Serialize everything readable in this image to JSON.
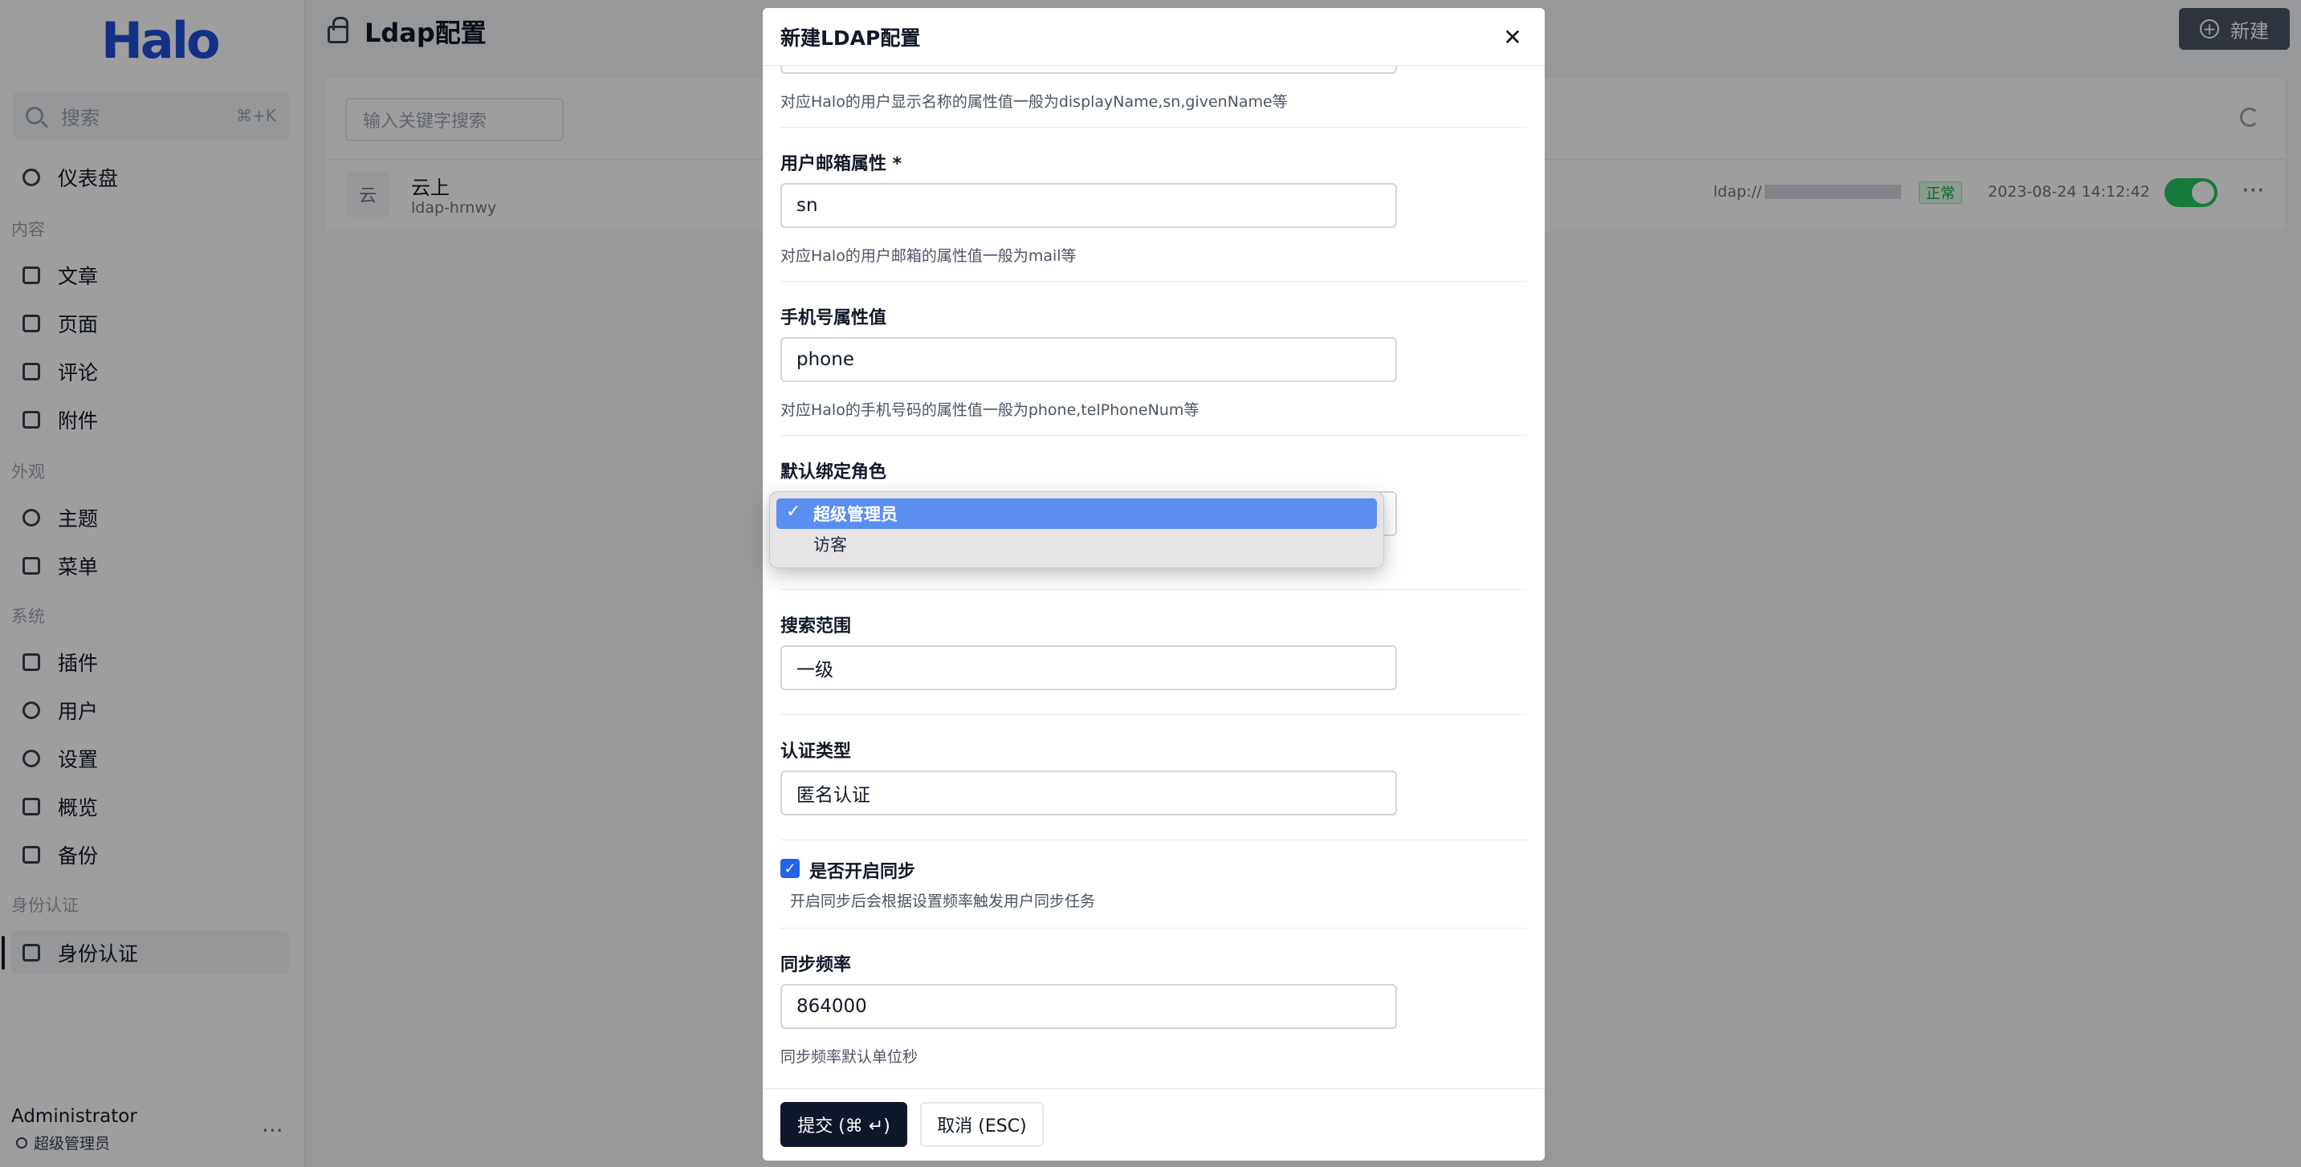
{
  "sidebar": {
    "logo": "Halo",
    "search": {
      "placeholder": "搜索",
      "shortcut": "⌘+K"
    },
    "items": [
      {
        "label": "仪表盘",
        "icon": "dashboard-icon"
      },
      {
        "label": "文章",
        "icon": "book-icon"
      },
      {
        "label": "页面",
        "icon": "page-icon"
      },
      {
        "label": "评论",
        "icon": "comment-icon"
      },
      {
        "label": "附件",
        "icon": "folder-icon"
      },
      {
        "label": "主题",
        "icon": "palette-icon"
      },
      {
        "label": "菜单",
        "icon": "menu-icon"
      },
      {
        "label": "插件",
        "icon": "plug-icon"
      },
      {
        "label": "用户",
        "icon": "user-icon"
      },
      {
        "label": "设置",
        "icon": "gear-icon"
      },
      {
        "label": "概览",
        "icon": "terminal-icon"
      },
      {
        "label": "备份",
        "icon": "backup-icon"
      },
      {
        "label": "身份认证",
        "icon": "lock-icon"
      }
    ],
    "groups": {
      "content": "内容",
      "appearance": "外观",
      "system": "系统",
      "auth": "身份认证"
    },
    "user": {
      "name": "Administrator",
      "role": "超级管理员",
      "more": "···"
    }
  },
  "main": {
    "title": "Ldap配置",
    "new_button": "新建",
    "search_placeholder": "输入关键字搜索",
    "row": {
      "avatar": "云",
      "title": "云上",
      "subtitle": "ldap-hrnwy",
      "url_prefix": "ldap://",
      "status": "正常",
      "time": "2023-08-24 14:12:42",
      "enabled": true,
      "more": "···"
    }
  },
  "modal": {
    "title": "新建LDAP配置",
    "close": "✕",
    "fields": {
      "display_name_help": "对应Halo的用户显示名称的属性值一般为displayName,sn,givenName等",
      "email_label": "用户邮箱属性 *",
      "email_value": "sn",
      "email_help": "对应Halo的用户邮箱的属性值一般为mail等",
      "phone_label": "手机号属性值",
      "phone_value": "phone",
      "phone_help": "对应Halo的手机号码的属性值一般为phone,telPhoneNum等",
      "role_label": "默认绑定角色",
      "scope_label": "搜索范围",
      "scope_value": "一级",
      "auth_label": "认证类型",
      "auth_value": "匿名认证",
      "sync_label": "是否开启同步",
      "sync_checked": true,
      "sync_help": "开启同步后会根据设置频率触发用户同步任务",
      "freq_label": "同步频率",
      "freq_value": "864000",
      "freq_help": "同步频率默认单位秒"
    },
    "submit": "提交 (⌘ ↵)",
    "cancel": "取消 (ESC)"
  },
  "dropdown": {
    "options": [
      "超级管理员",
      "访客"
    ],
    "selected": "超级管理员",
    "tick": "✓"
  }
}
